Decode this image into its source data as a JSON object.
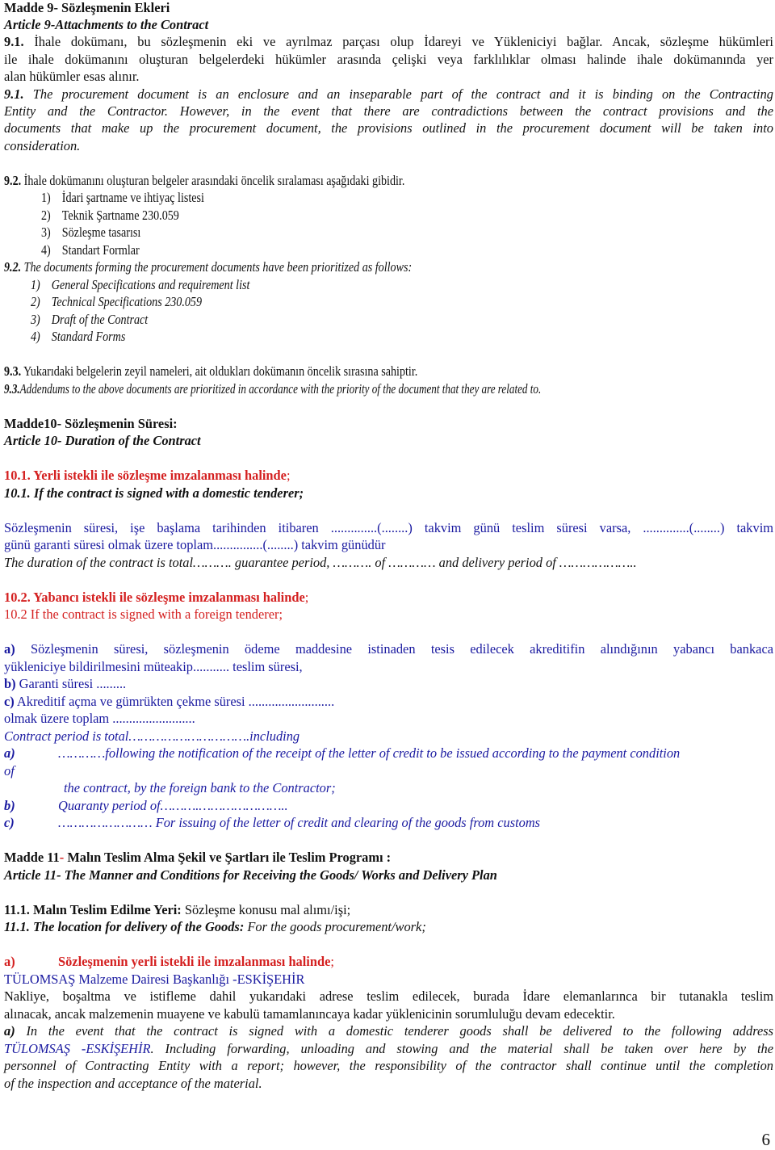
{
  "article9": {
    "title_tr": "Madde 9- Sözleşmenin Ekleri",
    "title_en": "Article 9-Attachments to the Contract",
    "p91_tr": {
      "num": "9.1.",
      "line1": " İhale dokümanı, bu sözleşmenin eki ve ayrılmaz parçası olup İdareyi ve Yükleniciyi bağlar. Ancak, sözleşme hükümleri",
      "line2": "ile ihale dokümanını oluşturan belgelerdeki hükümler arasında çelişki veya farklılıklar olması halinde ihale dokümanında yer",
      "line3": "alan hükümler esas alınır."
    },
    "p91_en": {
      "num": "9.1.",
      "line1": " The procurement document is an enclosure and an inseparable part of the contract and it is binding on the Contracting",
      "line2a": "Entity and the Contractor.",
      "line2b": " However, in the event that there are contradictions between the contract provisions and the",
      "line3": "documents that make up the procurement document, the provisions outlined in the procurement document will be taken into",
      "line4": "consideration."
    },
    "p92_tr": {
      "num": "9.2.",
      "text": " İhale dokümanını oluşturan belgeler arasındaki öncelik sıralaması aşağıdaki gibidir.",
      "items": [
        {
          "n": "1)",
          "t": "İdari şartname ve ihtiyaç listesi"
        },
        {
          "n": "2)",
          "t": "Teknik Şartname 230.059"
        },
        {
          "n": "3)",
          "t": "Sözleşme tasarısı"
        },
        {
          "n": "4)",
          "t": "Standart Formlar"
        }
      ]
    },
    "p92_en": {
      "num": "9.2.",
      "text": " The documents forming the procurement documents have been prioritized as follows:",
      "items": [
        {
          "n": "1)",
          "t": "General Specifications and requirement list"
        },
        {
          "n": "2)",
          "t": "Technical Specifications 230.059"
        },
        {
          "n": "3)",
          "t": "Draft of the Contract"
        },
        {
          "n": "4)",
          "t": "Standard Forms"
        }
      ]
    },
    "p93_tr": {
      "num": "9.3.",
      "text": " Yukarıdaki belgelerin zeyil nameleri, ait oldukları dokümanın öncelik sırasına sahiptir."
    },
    "p93_en": {
      "num": "9.3.",
      "text": "Addendums to the above documents are prioritized in accordance with the priority of the document that they are related to."
    }
  },
  "article10": {
    "title_tr": "Madde10- Sözleşmenin Süresi:",
    "title_en": "Article 10- Duration of the Contract",
    "s101_tr": "10.1. Yerli istekli ile sözleşme imzalanması halinde",
    "s101_tr_end": ";",
    "s101_en": "10.1. If the contract is signed with a domestic tenderer;",
    "s101_body1": "Sözleşmenin süresi, işe başlama tarihinden itibaren ..............(........) takvim günü teslim süresi varsa, ..............(........) takvim",
    "s101_body2": "günü garanti süresi olmak üzere toplam...............(........) takvim günüdür",
    "s101_body_en": "The duration of the contract is total……….  guarantee period, ………. of ………… and delivery period of ………………..",
    "s102_tr": "10.2. Yabancı istekli ile sözleşme imzalanması halinde",
    "s102_tr_end": ";",
    "s102_en": "10.2 If the contract is signed with a foreign tenderer;",
    "foreign_tr": {
      "a_label": "a)",
      "a_line1": " Sözleşmenin süresi, sözleşmenin ödeme maddesine istinaden tesis edilecek akreditifin alındığının yabancı bankaca",
      "a_line2": "yükleniciye bildirilmesini müteakip........... teslim süresi,",
      "b_label": "b)",
      "b_text": " Garanti süresi .........",
      "c_label": "c)",
      "c_text": " Akreditif açma ve gümrükten çekme süresi ..........................",
      "total": "olmak üzere toplam ........................."
    },
    "foreign_en": {
      "total": "Contract period is total………………………….including",
      "a_label": "a)",
      "a_line1": "…………following the notification of the receipt of the letter of credit to be issued according to the payment condition",
      "a_line2": "of",
      "a_line3": "the contract, by the foreign bank to the Contractor;",
      "b_label": "b)",
      "b_text": "Quaranty period of……….…………………..",
      "c_label": "c)",
      "c_text": "…………………… For issuing of the letter of credit and clearing of the goods from customs"
    }
  },
  "article11": {
    "title_tr_a": "Madde 11",
    "title_tr_dash": "-",
    "title_tr_b": " Malın Teslim Alma Şekil ve Şartları ile Teslim Programı :",
    "title_en": "Article 11- The Manner and Conditions for Receiving the Goods/ Works and Delivery Plan",
    "s111_tr_bold": "11.1.  Malın Teslim Edilme Yeri:",
    "s111_tr_rest": " Sözleşme konusu mal alımı/işi;",
    "s111_en_bold": "11.1. The location for delivery of the Goods:",
    "s111_en_rest": "  For the goods procurement/work;",
    "a_label": "a)",
    "a_heading": "Sözleşmenin yerli istekli ile imzalanması halinde",
    "a_heading_end": ";",
    "address": "TÜLOMSAŞ Malzeme Dairesi Başkanlığı -ESKİŞEHİR",
    "body_tr_line1": "Nakliye, boşaltma ve istifleme dahil yukarıdaki adrese teslim edilecek, burada İdare elemanlarınca bir tutanakla teslim",
    "body_tr_line2": "alınacak, ancak malzemenin muayene ve kabulü tamamlanıncaya kadar yüklenicinin sorumluluğu devam edecektir.",
    "body_en_label": "a)",
    "body_en_line1": " In the event that the contract is signed with a domestic tenderer goods shall be delivered to the following address",
    "body_en_addr": "TÜLOMSAŞ -ESKİŞEHİR",
    "body_en_line2": ". Including forwarding, unloading and stowing and the material shall be taken over here by the",
    "body_en_line3": "personnel of Contracting Entity with a report; however, the responsibility of the contractor shall continue until the completion",
    "body_en_line4": "of the inspection and acceptance of the material."
  },
  "page_number": "6",
  "colors": {
    "text": "#111111",
    "red": "#d42020",
    "blue": "#1a1aa0"
  }
}
